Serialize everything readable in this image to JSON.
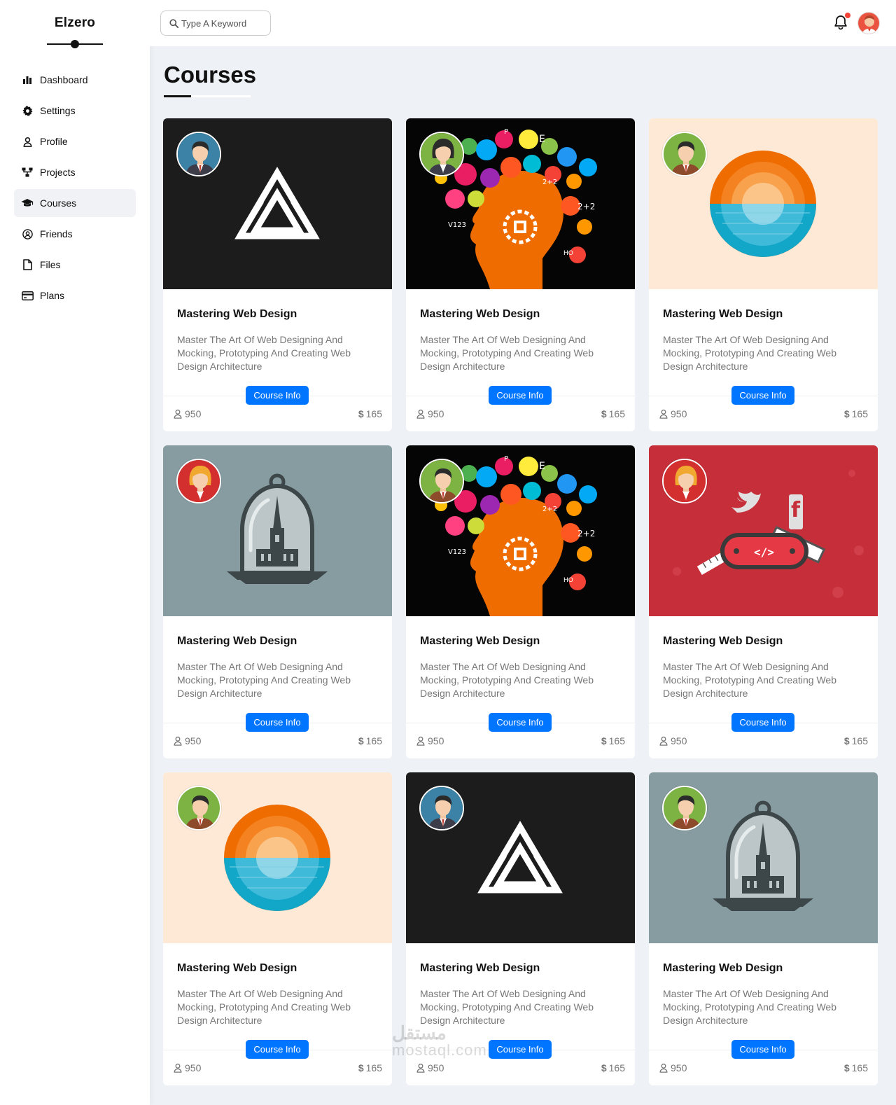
{
  "brand": {
    "title": "Elzero"
  },
  "sidebar": {
    "items": [
      {
        "label": "Dashboard",
        "icon": "bar-chart-icon",
        "active": false
      },
      {
        "label": "Settings",
        "icon": "gear-icon",
        "active": false
      },
      {
        "label": "Profile",
        "icon": "user-icon",
        "active": false
      },
      {
        "label": "Projects",
        "icon": "diagram-icon",
        "active": false
      },
      {
        "label": "Courses",
        "icon": "graduation-cap-icon",
        "active": true
      },
      {
        "label": "Friends",
        "icon": "user-circle-icon",
        "active": false
      },
      {
        "label": "Files",
        "icon": "file-icon",
        "active": false
      },
      {
        "label": "Plans",
        "icon": "credit-card-icon",
        "active": false
      }
    ]
  },
  "header": {
    "search_placeholder": "Type A Keyword",
    "notification_color": "#f44336"
  },
  "main": {
    "title": "Courses"
  },
  "colors": {
    "accent": "#0075ff",
    "background": "#eef1f5"
  },
  "courses": [
    {
      "title": "Mastering Web Design",
      "description": "Master The Art Of Web Designing And Mocking, Prototyping And Creating Web Design Architecture",
      "button": "Course Info",
      "students": "950",
      "currency": "$",
      "price": "165",
      "image": "dark-logo-a",
      "avatar": "teacher-male-blue"
    },
    {
      "title": "Mastering Web Design",
      "description": "Master The Art Of Web Designing And Mocking, Prototyping And Creating Web Design Architecture",
      "button": "Course Info",
      "students": "950",
      "currency": "$",
      "price": "165",
      "image": "science-head",
      "avatar": "teacher-female-green"
    },
    {
      "title": "Mastering Web Design",
      "description": "Master The Art Of Web Designing And Mocking, Prototyping And Creating Web Design Architecture",
      "button": "Course Info",
      "students": "950",
      "currency": "$",
      "price": "165",
      "image": "sunset-circle",
      "avatar": "teacher-male-green"
    },
    {
      "title": "Mastering Web Design",
      "description": "Master The Art Of Web Designing And Mocking, Prototyping And Creating Web Design Architecture",
      "button": "Course Info",
      "students": "950",
      "currency": "$",
      "price": "165",
      "image": "bell-jar-church",
      "avatar": "teacher-female-red"
    },
    {
      "title": "Mastering Web Design",
      "description": "Master The Art Of Web Designing And Mocking, Prototyping And Creating Web Design Architecture",
      "button": "Course Info",
      "students": "950",
      "currency": "$",
      "price": "165",
      "image": "science-head",
      "avatar": "teacher-male-green"
    },
    {
      "title": "Mastering Web Design",
      "description": "Master The Art Of Web Designing And Mocking, Prototyping And Creating Web Design Architecture",
      "button": "Course Info",
      "students": "950",
      "currency": "$",
      "price": "165",
      "image": "swiss-knife",
      "avatar": "teacher-female-red"
    },
    {
      "title": "Mastering Web Design",
      "description": "Master The Art Of Web Designing And Mocking, Prototyping And Creating Web Design Architecture",
      "button": "Course Info",
      "students": "950",
      "currency": "$",
      "price": "165",
      "image": "sunset-circle",
      "avatar": "teacher-male-green"
    },
    {
      "title": "Mastering Web Design",
      "description": "Master The Art Of Web Designing And Mocking, Prototyping And Creating Web Design Architecture",
      "button": "Course Info",
      "students": "950",
      "currency": "$",
      "price": "165",
      "image": "dark-logo-a",
      "avatar": "teacher-male-blue"
    },
    {
      "title": "Mastering Web Design",
      "description": "Master The Art Of Web Designing And Mocking, Prototyping And Creating Web Design Architecture",
      "button": "Course Info",
      "students": "950",
      "currency": "$",
      "price": "165",
      "image": "bell-jar-church",
      "avatar": "teacher-male-green"
    }
  ],
  "watermark": {
    "arabic": "مستقل",
    "latin": "mostaql.com"
  }
}
